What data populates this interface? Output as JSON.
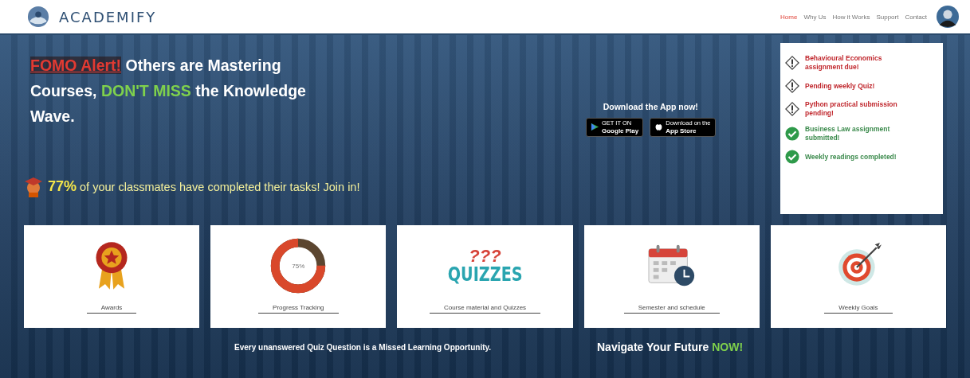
{
  "header": {
    "brand": "ACADEMIFY",
    "nav": [
      {
        "label": "Home",
        "selected": true
      },
      {
        "label": "Why Us",
        "selected": false
      },
      {
        "label": "How it Works",
        "selected": false
      },
      {
        "label": "Support",
        "selected": false
      },
      {
        "label": "Contact",
        "selected": false
      }
    ]
  },
  "hero": {
    "headline": [
      {
        "kind": "alert",
        "text": "FOMO Alert!"
      },
      {
        "kind": "plain",
        "text": " Others are Mastering Courses, "
      },
      {
        "kind": "highlight",
        "text": "DON'T MISS"
      },
      {
        "kind": "plain",
        "text": " the Knowledge Wave."
      }
    ],
    "stat": [
      {
        "kind": "figure",
        "text": "77%"
      },
      {
        "kind": "plain",
        "text": " of your classmates have completed their tasks! Join in!"
      }
    ],
    "download": {
      "title": "Download the App now!",
      "stores": [
        {
          "kind": "google",
          "small": "GET IT ON",
          "name": "Google Play"
        },
        {
          "kind": "apple",
          "small": "Download on the",
          "name": "App Store"
        }
      ]
    }
  },
  "notifications": [
    {
      "kind": "pending",
      "text": "Behavioural Economics assignment due!"
    },
    {
      "kind": "pending",
      "text": "Pending weekly Quiz!"
    },
    {
      "kind": "pending",
      "text": "Python practical submission pending!"
    },
    {
      "kind": "done",
      "text": "Business Law assignment submitted!"
    },
    {
      "kind": "done",
      "text": "Weekly readings completed!"
    }
  ],
  "cards": [
    {
      "kind": "award",
      "label": "Awards"
    },
    {
      "kind": "progress",
      "label": "Progress Tracking",
      "reading": "75%",
      "level": 0.75
    },
    {
      "kind": "quiz",
      "label": "Course material and Quizzes",
      "word": "QUIZZES",
      "marks": "???"
    },
    {
      "kind": "calendar",
      "label": "Semester and schedule"
    },
    {
      "kind": "target",
      "label": "Weekly Goals"
    }
  ],
  "footer": {
    "message": "Every unanswered Quiz Question is a Missed Learning Opportunity.",
    "cta": [
      {
        "kind": "plain",
        "text": "Navigate Your Future "
      },
      {
        "kind": "highlight",
        "text": "NOW!"
      }
    ]
  }
}
